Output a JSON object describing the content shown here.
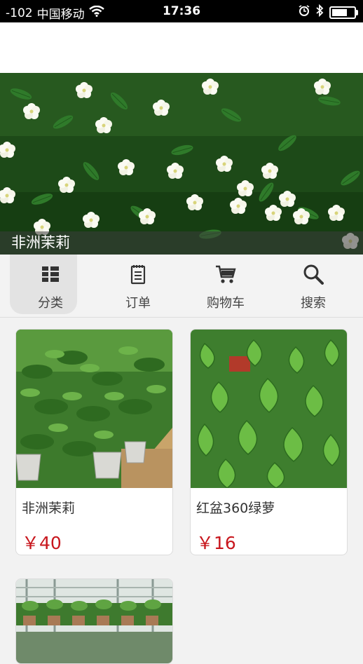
{
  "status_bar": {
    "signal": "-102",
    "carrier": "中国移动",
    "time": "17:36",
    "wifi_icon": "wifi-icon",
    "alarm_icon": "alarm-icon",
    "bluetooth_icon": "bluetooth-icon",
    "battery_level": 0.75
  },
  "banner": {
    "caption": "非洲茉莉"
  },
  "categories": [
    {
      "label": "分类",
      "icon": "grid-icon",
      "active": true
    },
    {
      "label": "订单",
      "icon": "order-notepad-icon",
      "active": false
    },
    {
      "label": "购物车",
      "icon": "cart-icon",
      "active": false
    },
    {
      "label": "搜索",
      "icon": "search-icon",
      "active": false
    }
  ],
  "products": [
    {
      "name": "非洲茉莉",
      "price": "￥40"
    },
    {
      "name": "红盆360绿萝",
      "price": "￥16"
    },
    {
      "name": "",
      "price": ""
    }
  ],
  "colors": {
    "price": "#c8161d",
    "status_bar": "#000000",
    "background": "#f2f2f2"
  }
}
